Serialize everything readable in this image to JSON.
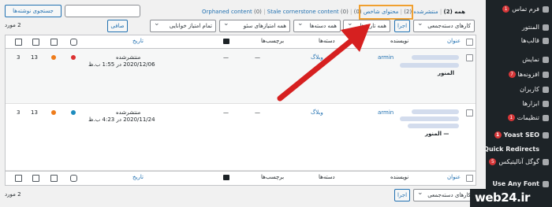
{
  "sidebar": {
    "items": [
      {
        "label": "فرم تماس",
        "badge": "1"
      },
      {
        "label": "المنتور",
        "badge": ""
      },
      {
        "label": "قالب‌ها",
        "badge": ""
      },
      {
        "label": "نمایش",
        "badge": ""
      },
      {
        "label": "افزونه‌ها",
        "badge": "7"
      },
      {
        "label": "کاربران",
        "badge": ""
      },
      {
        "label": "ابزارها",
        "badge": ""
      },
      {
        "label": "تنظیمات",
        "badge": "1"
      },
      {
        "label": "Yoast SEO",
        "badge": "1"
      },
      {
        "label": "Quick Redirects",
        "badge": ""
      },
      {
        "label": "گوگل آنالیتیکس",
        "badge": "5"
      },
      {
        "label": "Use Any Font",
        "badge": ""
      }
    ]
  },
  "filters": {
    "all": "همه",
    "all_count": "(2)",
    "published": "منتشرشده",
    "published_count": "(2)",
    "orphaned_fa": "محتوای شاخص",
    "orphaned_fa_count": "(0)",
    "orphaned_en": "Orphaned content",
    "orphaned_en_count": "(0)",
    "stale": "Stale cornerstone content",
    "stale_count": "(0)",
    "sep": "|"
  },
  "search": {
    "button": "جستجوی نوشته‌ها",
    "placeholder": ""
  },
  "toolbar": {
    "bulk_actions": "کارهای دسته‌جمعی",
    "apply": "اجرا",
    "all_dates": "همه تاریخ‌ها",
    "all_categories": "همه دسته‌ها",
    "all_seo_scores": "همه امتیازهای سئو",
    "all_readability": "تمام امتیاز خوانایی",
    "filter": "صافی",
    "items_count": "2 مورد"
  },
  "columns": {
    "title": "عنوان",
    "author": "نویسنده",
    "categories": "دسته‌ها",
    "tags": "برچسب‌ها",
    "date": "تاریخ"
  },
  "rows": [
    {
      "title_suffix": "المنور",
      "author": "armin",
      "category": "وبلاگ",
      "tags": "—",
      "comments": "—",
      "status": "منتشرشده",
      "date": "2020/12/06 در 1:55 ب.ظ",
      "links_in": "13",
      "links_out": "3",
      "seo_color": "#dc3232",
      "read_color": "#ee7c1b"
    },
    {
      "title_suffix": "— المنور",
      "author": "armin",
      "category": "وبلاگ",
      "tags": "—",
      "comments": "—",
      "status": "منتشرشده",
      "date": "2020/11/24 در 4:23 ب.ظ",
      "links_in": "13",
      "links_out": "3",
      "seo_color": "#1e8cbe",
      "read_color": "#ee7c1b"
    }
  ],
  "bottom": {
    "bulk_actions": "کارهای دسته‌جمعی",
    "apply": "اجرا",
    "items_count": "2 مورد"
  },
  "watermark": {
    "text": "web24.ir"
  },
  "colors": {
    "accent": "#2271b1",
    "highlight": "#f0a030",
    "arrow": "#d62020",
    "sidebar": "#1d2327"
  }
}
